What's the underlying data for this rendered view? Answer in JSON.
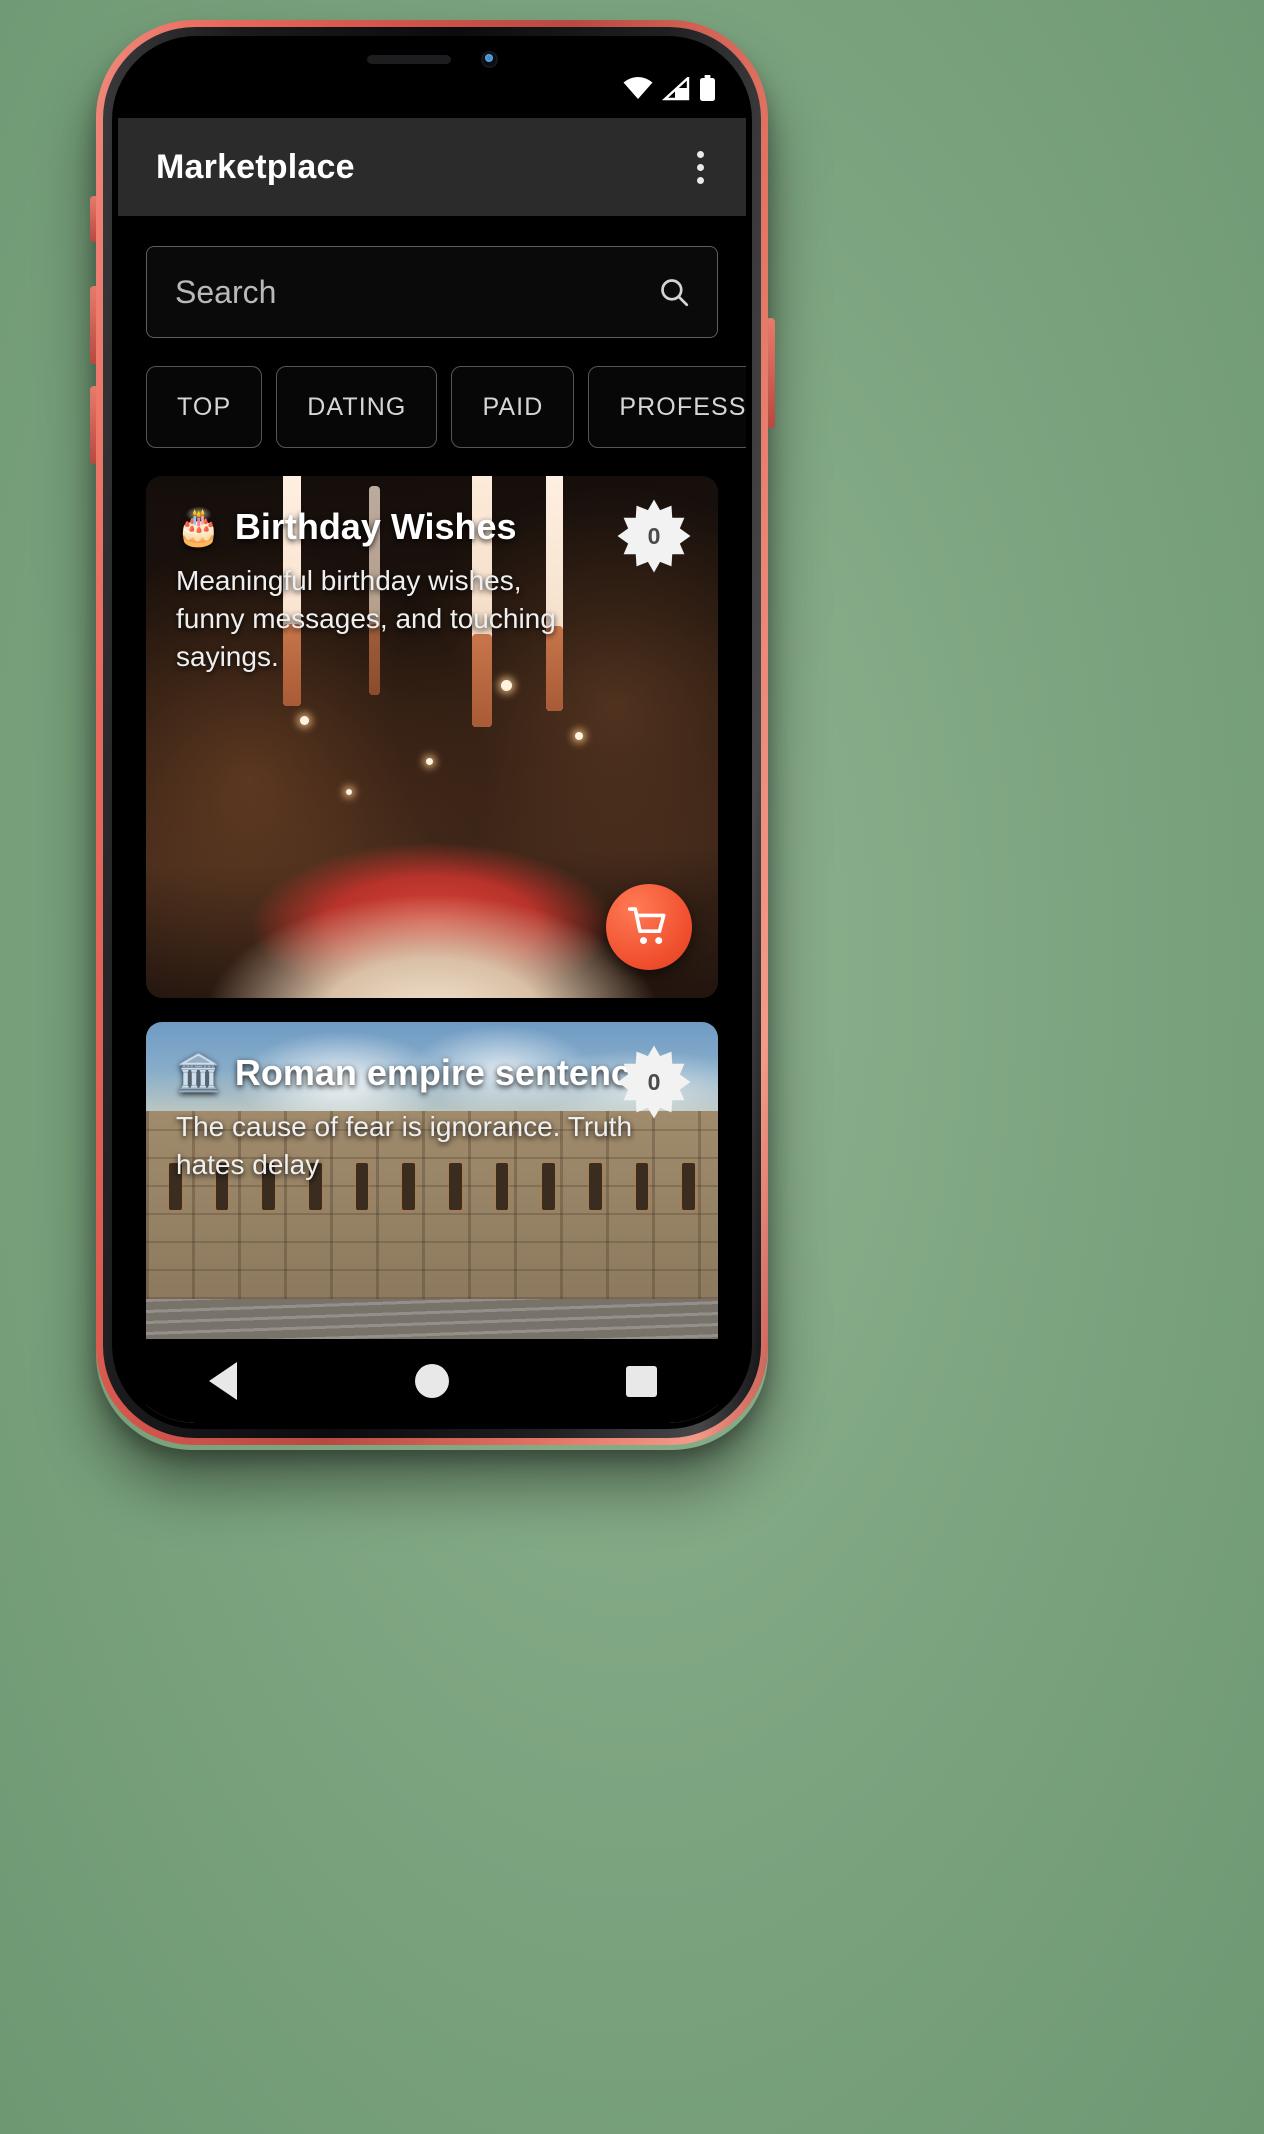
{
  "statusbar": {
    "wifi_icon": "wifi-icon",
    "signal_icon": "signal-icon",
    "battery_icon": "battery-icon"
  },
  "appbar": {
    "title": "Marketplace",
    "overflow_icon": "more-vert-icon"
  },
  "search": {
    "placeholder": "Search",
    "icon": "search-icon"
  },
  "chips": [
    {
      "label": "TOP"
    },
    {
      "label": "DATING"
    },
    {
      "label": "PAID"
    },
    {
      "label": "PROFESSIONAL"
    }
  ],
  "cards": [
    {
      "emoji": "🎂",
      "emoji_name": "birthday-cake-icon",
      "title": "Birthday Wishes",
      "description": "Meaningful birthday wishes, funny messages, and touching sayings.",
      "badge_count": "0",
      "fab_icon": "shopping-cart-icon"
    },
    {
      "emoji": "🏛️",
      "emoji_name": "classical-building-icon",
      "title": "Roman empire sentences",
      "description": "The cause of fear is ignorance. Truth hates delay",
      "badge_count": "0",
      "fab_icon": "shopping-cart-icon"
    }
  ],
  "navbar": {
    "back": "back-button",
    "home": "home-button",
    "recents": "recents-button"
  },
  "colors": {
    "accent": "#f1502f",
    "appbar_bg": "#2b2b2b",
    "screen_bg": "#000000",
    "phone_frame": "#d4564c",
    "chip_border": "#555555",
    "placeholder_text": "#b9b9b9"
  }
}
